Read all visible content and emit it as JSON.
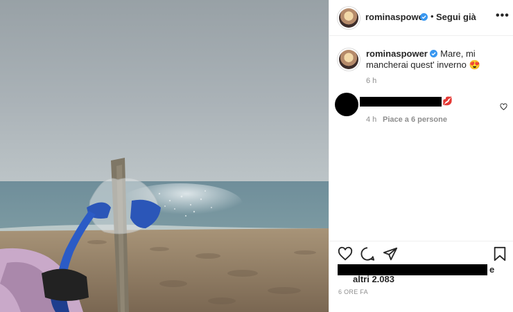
{
  "post": {
    "username": "rominaspower",
    "follow_label": "Segui già",
    "follow_separator": "•",
    "more_label": "•••",
    "caption_text": "Mare, mi mancherai quest' inverno",
    "caption_emoji": "😍",
    "caption_time": "6 h",
    "comment": {
      "emoji": "💋",
      "time": "4 h",
      "likes": "Piace a 6 persone"
    },
    "likes_suffix": "e",
    "likes_others": "altri 2.083",
    "posted_ago": "6 ORE FA"
  },
  "icons": {
    "verified": "verified-badge-icon",
    "like": "heart-icon",
    "comment": "comment-icon",
    "share": "paper-plane-icon",
    "save": "bookmark-icon",
    "comment_like": "small-heart-icon"
  },
  "colors": {
    "verified": "#3897f0",
    "text": "#262626",
    "muted": "#8e8e8e",
    "border": "#efefef"
  }
}
